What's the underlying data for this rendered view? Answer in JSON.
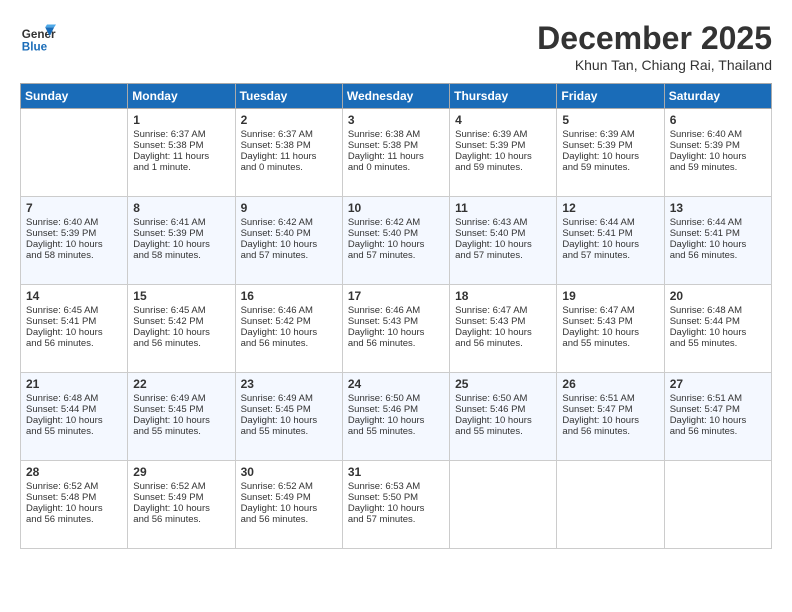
{
  "header": {
    "logo_text1": "General",
    "logo_text2": "Blue",
    "month": "December 2025",
    "location": "Khun Tan, Chiang Rai, Thailand"
  },
  "days_of_week": [
    "Sunday",
    "Monday",
    "Tuesday",
    "Wednesday",
    "Thursday",
    "Friday",
    "Saturday"
  ],
  "weeks": [
    [
      {
        "day": "",
        "info": ""
      },
      {
        "day": "1",
        "info": "Sunrise: 6:37 AM\nSunset: 5:38 PM\nDaylight: 11 hours\nand 1 minute."
      },
      {
        "day": "2",
        "info": "Sunrise: 6:37 AM\nSunset: 5:38 PM\nDaylight: 11 hours\nand 0 minutes."
      },
      {
        "day": "3",
        "info": "Sunrise: 6:38 AM\nSunset: 5:38 PM\nDaylight: 11 hours\nand 0 minutes."
      },
      {
        "day": "4",
        "info": "Sunrise: 6:39 AM\nSunset: 5:39 PM\nDaylight: 10 hours\nand 59 minutes."
      },
      {
        "day": "5",
        "info": "Sunrise: 6:39 AM\nSunset: 5:39 PM\nDaylight: 10 hours\nand 59 minutes."
      },
      {
        "day": "6",
        "info": "Sunrise: 6:40 AM\nSunset: 5:39 PM\nDaylight: 10 hours\nand 59 minutes."
      }
    ],
    [
      {
        "day": "7",
        "info": "Sunrise: 6:40 AM\nSunset: 5:39 PM\nDaylight: 10 hours\nand 58 minutes."
      },
      {
        "day": "8",
        "info": "Sunrise: 6:41 AM\nSunset: 5:39 PM\nDaylight: 10 hours\nand 58 minutes."
      },
      {
        "day": "9",
        "info": "Sunrise: 6:42 AM\nSunset: 5:40 PM\nDaylight: 10 hours\nand 57 minutes."
      },
      {
        "day": "10",
        "info": "Sunrise: 6:42 AM\nSunset: 5:40 PM\nDaylight: 10 hours\nand 57 minutes."
      },
      {
        "day": "11",
        "info": "Sunrise: 6:43 AM\nSunset: 5:40 PM\nDaylight: 10 hours\nand 57 minutes."
      },
      {
        "day": "12",
        "info": "Sunrise: 6:44 AM\nSunset: 5:41 PM\nDaylight: 10 hours\nand 57 minutes."
      },
      {
        "day": "13",
        "info": "Sunrise: 6:44 AM\nSunset: 5:41 PM\nDaylight: 10 hours\nand 56 minutes."
      }
    ],
    [
      {
        "day": "14",
        "info": "Sunrise: 6:45 AM\nSunset: 5:41 PM\nDaylight: 10 hours\nand 56 minutes."
      },
      {
        "day": "15",
        "info": "Sunrise: 6:45 AM\nSunset: 5:42 PM\nDaylight: 10 hours\nand 56 minutes."
      },
      {
        "day": "16",
        "info": "Sunrise: 6:46 AM\nSunset: 5:42 PM\nDaylight: 10 hours\nand 56 minutes."
      },
      {
        "day": "17",
        "info": "Sunrise: 6:46 AM\nSunset: 5:43 PM\nDaylight: 10 hours\nand 56 minutes."
      },
      {
        "day": "18",
        "info": "Sunrise: 6:47 AM\nSunset: 5:43 PM\nDaylight: 10 hours\nand 56 minutes."
      },
      {
        "day": "19",
        "info": "Sunrise: 6:47 AM\nSunset: 5:43 PM\nDaylight: 10 hours\nand 55 minutes."
      },
      {
        "day": "20",
        "info": "Sunrise: 6:48 AM\nSunset: 5:44 PM\nDaylight: 10 hours\nand 55 minutes."
      }
    ],
    [
      {
        "day": "21",
        "info": "Sunrise: 6:48 AM\nSunset: 5:44 PM\nDaylight: 10 hours\nand 55 minutes."
      },
      {
        "day": "22",
        "info": "Sunrise: 6:49 AM\nSunset: 5:45 PM\nDaylight: 10 hours\nand 55 minutes."
      },
      {
        "day": "23",
        "info": "Sunrise: 6:49 AM\nSunset: 5:45 PM\nDaylight: 10 hours\nand 55 minutes."
      },
      {
        "day": "24",
        "info": "Sunrise: 6:50 AM\nSunset: 5:46 PM\nDaylight: 10 hours\nand 55 minutes."
      },
      {
        "day": "25",
        "info": "Sunrise: 6:50 AM\nSunset: 5:46 PM\nDaylight: 10 hours\nand 55 minutes."
      },
      {
        "day": "26",
        "info": "Sunrise: 6:51 AM\nSunset: 5:47 PM\nDaylight: 10 hours\nand 56 minutes."
      },
      {
        "day": "27",
        "info": "Sunrise: 6:51 AM\nSunset: 5:47 PM\nDaylight: 10 hours\nand 56 minutes."
      }
    ],
    [
      {
        "day": "28",
        "info": "Sunrise: 6:52 AM\nSunset: 5:48 PM\nDaylight: 10 hours\nand 56 minutes."
      },
      {
        "day": "29",
        "info": "Sunrise: 6:52 AM\nSunset: 5:49 PM\nDaylight: 10 hours\nand 56 minutes."
      },
      {
        "day": "30",
        "info": "Sunrise: 6:52 AM\nSunset: 5:49 PM\nDaylight: 10 hours\nand 56 minutes."
      },
      {
        "day": "31",
        "info": "Sunrise: 6:53 AM\nSunset: 5:50 PM\nDaylight: 10 hours\nand 57 minutes."
      },
      {
        "day": "",
        "info": ""
      },
      {
        "day": "",
        "info": ""
      },
      {
        "day": "",
        "info": ""
      }
    ]
  ]
}
